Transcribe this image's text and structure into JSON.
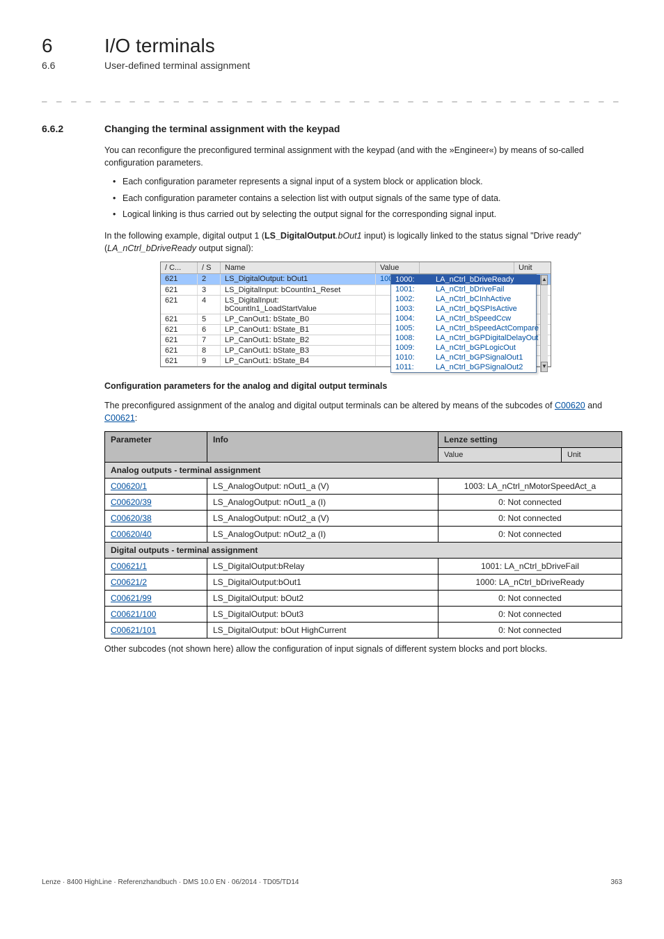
{
  "chapter": {
    "num": "6",
    "title": "I/O terminals"
  },
  "subsection": {
    "num": "6.6",
    "title": "User-defined terminal assignment"
  },
  "dash_sep": "_ _ _ _ _ _ _ _ _ _ _ _ _ _ _ _ _ _ _ _ _ _ _ _ _ _ _ _ _ _ _ _ _ _ _ _ _ _ _ _ _ _ _ _ _ _ _ _ _ _ _ _ _ _ _ _ _ _ _ _ _ _ _",
  "section": {
    "num": "6.6.2",
    "title": "Changing the terminal assignment with the keypad"
  },
  "intro": "You can reconfigure the preconfigured terminal assignment with the keypad (and with the »Engineer«) by means of so-called configuration parameters.",
  "bullets": [
    "Each configuration parameter represents a signal input of a system block or application block.",
    "Each configuration parameter contains a selection list with output signals of the same type of data.",
    "Logical linking is thus carried out by selecting the output signal for the corresponding signal input."
  ],
  "example_prefix": "In the following example, digital output 1 (",
  "example_sig1": "LS_DigitalOutput",
  "example_sig1b": ".bOut1",
  "example_mid": " input) is logically linked to the status signal \"Drive ready\" (",
  "example_sig2": "LA_nCtrl_bDriveReady",
  "example_suffix": " output signal):",
  "scr": {
    "headers": {
      "c": "/ C...",
      "s": "/ S",
      "name": "Name",
      "value": "Value",
      "unit": "Unit"
    },
    "rows": [
      {
        "c": "621",
        "s": "2",
        "name": "LS_DigitalOutput: bOut1",
        "val": "1000:",
        "sig": "LA_nCtrl_bDriveRea",
        "sel": true
      },
      {
        "c": "621",
        "s": "3",
        "name": "LS_DigitalInput: bCountIn1_Reset",
        "val": "",
        "sig": ""
      },
      {
        "c": "621",
        "s": "4",
        "name": "LS_DigitalInput: bCountIn1_LoadStartValue",
        "val": "",
        "sig": ""
      },
      {
        "c": "621",
        "s": "5",
        "name": "LP_CanOut1: bState_B0",
        "val": "",
        "sig": ""
      },
      {
        "c": "621",
        "s": "6",
        "name": "LP_CanOut1: bState_B1",
        "val": "",
        "sig": ""
      },
      {
        "c": "621",
        "s": "7",
        "name": "LP_CanOut1: bState_B2",
        "val": "",
        "sig": ""
      },
      {
        "c": "621",
        "s": "8",
        "name": "LP_CanOut1: bState_B3",
        "val": "",
        "sig": ""
      },
      {
        "c": "621",
        "s": "9",
        "name": "LP_CanOut1: bState_B4",
        "val": "",
        "sig": ""
      }
    ],
    "dropdown": [
      {
        "code": "1000:",
        "label": "LA_nCtrl_bDriveReady",
        "hl": true
      },
      {
        "code": "1001:",
        "label": "LA_nCtrl_bDriveFail"
      },
      {
        "code": "1002:",
        "label": "LA_nCtrl_bCInhActive"
      },
      {
        "code": "1003:",
        "label": "LA_nCtrl_bQSPIsActive"
      },
      {
        "code": "1004:",
        "label": "LA_nCtrl_bSpeedCcw"
      },
      {
        "code": "1005:",
        "label": "LA_nCtrl_bSpeedActCompare"
      },
      {
        "code": "1008:",
        "label": "LA_nCtrl_bGPDigitalDelayOut"
      },
      {
        "code": "1009:",
        "label": "LA_nCtrl_bGPLogicOut"
      },
      {
        "code": "1010:",
        "label": "LA_nCtrl_bGPSignalOut1"
      },
      {
        "code": "1011:",
        "label": "LA_nCtrl_bGPSignalOut2"
      }
    ]
  },
  "cfg_heading": "Configuration parameters for the analog and digital output terminals",
  "cfg_intro_a": "The preconfigured assignment of the analog and digital output terminals can be altered by means of the subcodes of ",
  "cfg_link1": "C00620",
  "cfg_intro_b": " and ",
  "cfg_link2": "C00621",
  "cfg_intro_c": ":",
  "table": {
    "h_param": "Parameter",
    "h_info": "Info",
    "h_setting": "Lenze setting",
    "h_value": "Value",
    "h_unit": "Unit",
    "group1": "Analog outputs - terminal assignment",
    "rows1": [
      {
        "p": "C00620/1",
        "i": "LS_AnalogOutput: nOut1_a (V)",
        "s": "1003: LA_nCtrl_nMotorSpeedAct_a"
      },
      {
        "p": "C00620/39",
        "i": "LS_AnalogOutput: nOut1_a (I)",
        "s": "0: Not connected"
      },
      {
        "p": "C00620/38",
        "i": "LS_AnalogOutput: nOut2_a (V)",
        "s": "0: Not connected"
      },
      {
        "p": "C00620/40",
        "i": "LS_AnalogOutput: nOut2_a (I)",
        "s": "0: Not connected"
      }
    ],
    "group2": "Digital outputs - terminal assignment",
    "rows2": [
      {
        "p": "C00621/1",
        "i": "LS_DigitalOutput:bRelay",
        "s": "1001: LA_nCtrl_bDriveFail"
      },
      {
        "p": "C00621/2",
        "i": "LS_DigitalOutput:bOut1",
        "s": "1000: LA_nCtrl_bDriveReady"
      },
      {
        "p": "C00621/99",
        "i": "LS_DigitalOutput: bOut2",
        "s": "0: Not connected"
      },
      {
        "p": "C00621/100",
        "i": "LS_DigitalOutput: bOut3",
        "s": "0: Not connected"
      },
      {
        "p": "C00621/101",
        "i": "LS_DigitalOutput: bOut HighCurrent",
        "s": "0: Not connected"
      }
    ]
  },
  "after_table": "Other subcodes (not shown here) allow the configuration of input signals of different system blocks and port blocks.",
  "footer_left": "Lenze · 8400 HighLine · Referenzhandbuch · DMS 10.0 EN · 06/2014 · TD05/TD14",
  "footer_right": "363"
}
